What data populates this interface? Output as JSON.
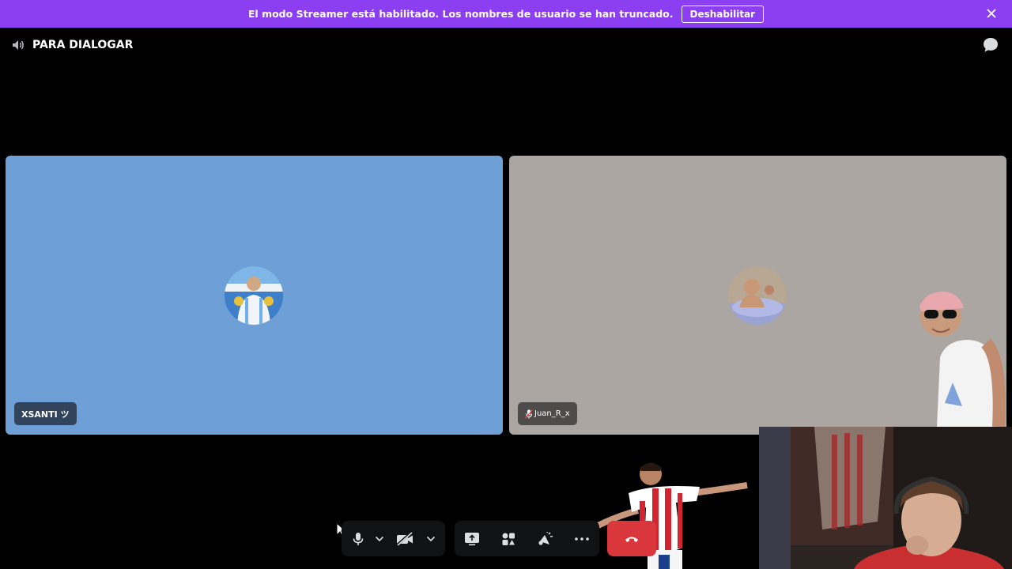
{
  "banner": {
    "text": "El modo Streamer está habilitado. Los nombres de usuario se han truncado.",
    "button_label": "Deshabilitar",
    "color": "#8b3ff0"
  },
  "channel": {
    "name": "PARA DIALOGAR",
    "icon": "speaker-icon"
  },
  "participants": [
    {
      "name": "XSANTI ツ",
      "tile_color": "#6f9fd7",
      "muted": false
    },
    {
      "name": "Juan_R_x",
      "tile_color": "#aba6a1",
      "muted": true
    }
  ],
  "controls": {
    "icons": [
      "microphone-icon",
      "camera-off-icon",
      "screen-share-icon",
      "activities-icon",
      "soundboard-icon",
      "more-icon",
      "hang-up-icon"
    ],
    "hangup_color": "#da373c"
  }
}
